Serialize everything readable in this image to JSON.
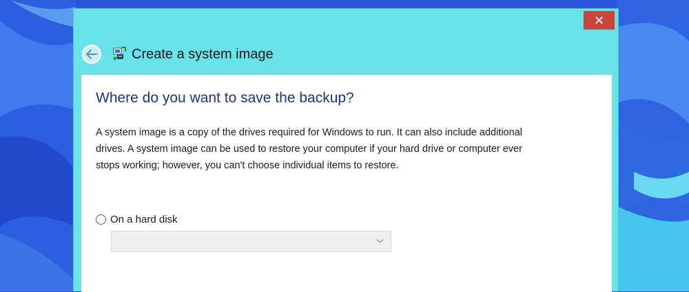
{
  "window": {
    "title": "Create a system image",
    "close_glyph": "✕",
    "back_icon": "back-arrow-icon",
    "title_icon": "system-image-icon"
  },
  "main": {
    "heading": "Where do you want to save the backup?",
    "description": "A system image is a copy of the drives required for Windows to run. It can also include additional drives. A system image can be used to restore your computer if your hard drive or computer ever stops working; however, you can't choose individual items to restore.",
    "options": [
      {
        "label": "On a hard disk",
        "selected": false
      }
    ],
    "dropdown": {
      "value": "",
      "enabled": false
    }
  },
  "colors": {
    "window_frame": "#69e2e9",
    "close_button": "#c7453a",
    "heading": "#1e3287",
    "desktop": "#2a55d8"
  }
}
